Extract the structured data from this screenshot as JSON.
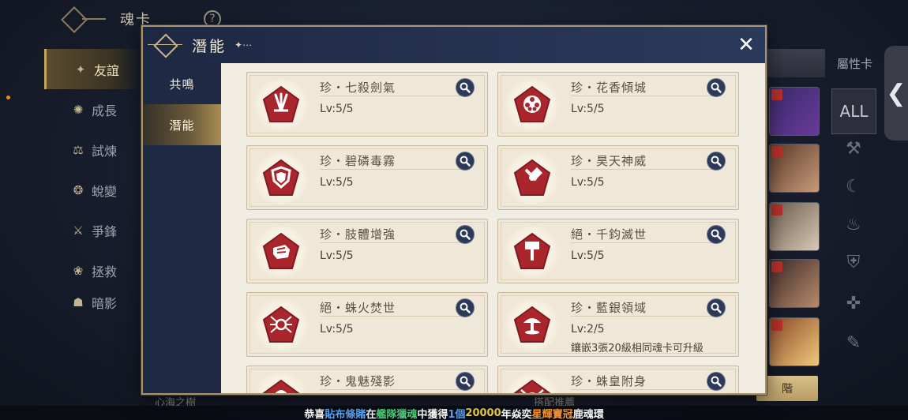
{
  "background": {
    "title": "魂卡",
    "help": "?",
    "nav": [
      {
        "label": "友誼",
        "icon": "✦",
        "active": true
      },
      {
        "label": "成長",
        "icon": "✺"
      },
      {
        "label": "試煉",
        "icon": "⚖"
      },
      {
        "label": "蛻變",
        "icon": "❂"
      },
      {
        "label": "爭鋒",
        "icon": "⚔"
      },
      {
        "label": "拯救",
        "icon": "❀"
      },
      {
        "label": "暗影",
        "icon": "☗"
      }
    ],
    "right_tabs": [
      "",
      "屬性卡"
    ],
    "all_label": "ALL",
    "side_handle": "❮",
    "bottom_left": "心海之樹",
    "bottom_mid": "搭配推薦",
    "bottom_right": "階"
  },
  "ticker": {
    "prefix": "恭喜",
    "player": "貼布條賭",
    "at": "在",
    "place": "艦隊獵魂",
    "mid": "中獲得",
    "count": "1個",
    "amount": "20000",
    "mid2": "年焱奕",
    "item": "星輝寶冠",
    "suffix": "鹿魂環"
  },
  "modal": {
    "title": "潛能",
    "title_deco": "✦⋯",
    "close": "✕",
    "side_tabs": [
      {
        "label": "共鳴",
        "active": false
      },
      {
        "label": "潛能",
        "active": true
      }
    ]
  },
  "cards": [
    {
      "name": "珍・七殺劍氣",
      "level": "Lv:5/5",
      "note": "",
      "icon": "swords-icon"
    },
    {
      "name": "珍・花香傾城",
      "level": "Lv:5/5",
      "note": "",
      "icon": "flower-icon"
    },
    {
      "name": "珍・碧磷毒霧",
      "level": "Lv:5/5",
      "note": "",
      "icon": "shield-icon"
    },
    {
      "name": "珍・昊天神威",
      "level": "Lv:5/5",
      "note": "",
      "icon": "hammer-icon"
    },
    {
      "name": "珍・肢體增強",
      "level": "Lv:5/5",
      "note": "",
      "icon": "fist-icon"
    },
    {
      "name": "絕・千鈞滅世",
      "level": "Lv:5/5",
      "note": "",
      "icon": "great-hammer-icon"
    },
    {
      "name": "絕・蛛火焚世",
      "level": "Lv:5/5",
      "note": "",
      "icon": "spider-icon"
    },
    {
      "name": "珍・藍銀領域",
      "level": "Lv:2/5",
      "note": "鑲嵌3張20級相同魂卡可升級",
      "icon": "tree-icon"
    },
    {
      "name": "珍・鬼魅殘影",
      "level": "",
      "note": "",
      "icon": "ghost-icon"
    },
    {
      "name": "珍・蛛皇附身",
      "level": "",
      "note": "",
      "icon": "spider-king-icon"
    }
  ],
  "colors": {
    "gem_red": "#a8262c",
    "gem_dark": "#7e1a20",
    "card_bg": "#efe8d8",
    "modal_frame": "#a89370"
  }
}
